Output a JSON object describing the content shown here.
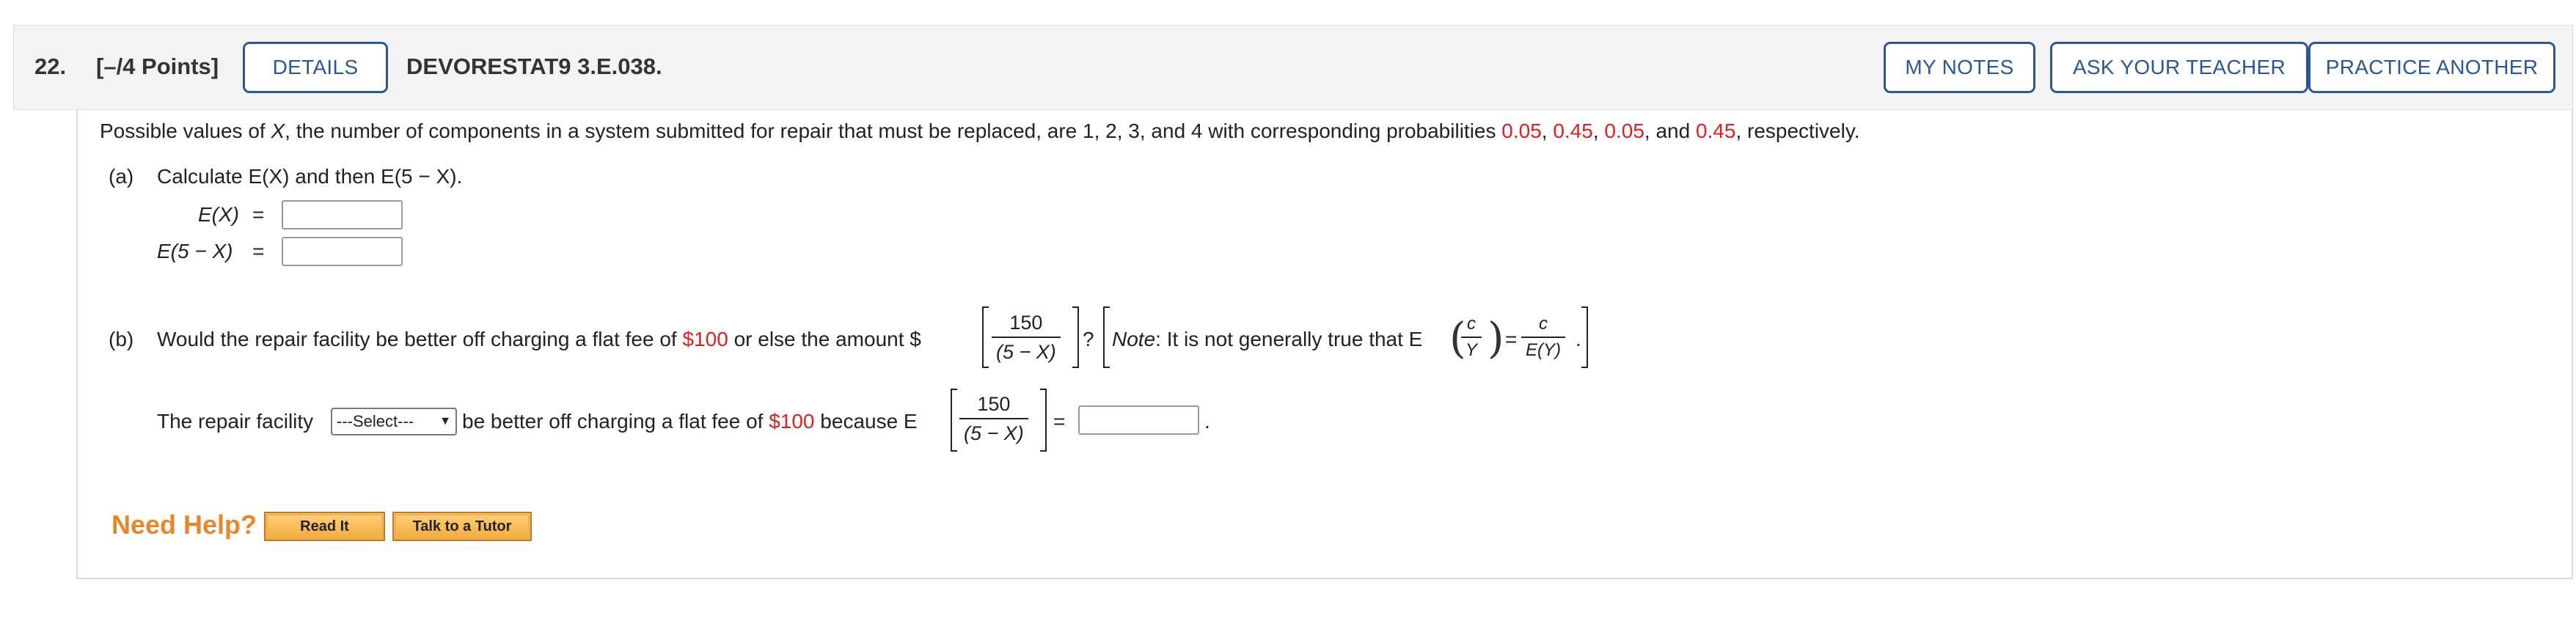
{
  "header": {
    "question_number": "22.",
    "points": "[–/4 Points]",
    "details_label": "DETAILS",
    "problem_code": "DEVORESTAT9 3.E.038.",
    "my_notes_label": "MY NOTES",
    "ask_teacher_label": "ASK YOUR TEACHER",
    "practice_another_label": "PRACTICE ANOTHER"
  },
  "intro": {
    "p1": "Possible values of ",
    "var_x": "X",
    "p2": ", the number of components in a system submitted for repair that must be replaced, are 1, 2, 3, and 4 with corresponding probabilities ",
    "prob1": "0.05",
    "sep1": ", ",
    "prob2": "0.45",
    "sep2": ", ",
    "prob3": "0.05",
    "sep3": ", and ",
    "prob4": "0.45",
    "p3": ", respectively."
  },
  "part_a": {
    "label": "(a)",
    "prompt": "Calculate E(X) and then E(5 − X).",
    "ex_label": "E(X)",
    "ex_equals": "=",
    "e5x_label": "E(5 − X)",
    "e5x_equals": "=",
    "ex_value": "",
    "e5x_value": ""
  },
  "part_b": {
    "label": "(b)",
    "prompt_1": "Would the repair facility be better off charging a flat fee of ",
    "fee": "$100",
    "prompt_2": " or else the amount $",
    "frac_num": "150",
    "frac_den": "(5 − X)",
    "qmark": "?",
    "note_label": "Note",
    "note_text": ": It is not generally true that E",
    "note_frac_num": "c",
    "note_frac_den": "Y",
    "note_equals": "=",
    "note_rhs_num": "c",
    "note_rhs_den": "E(Y)",
    "note_end": ".",
    "answer_1": "The repair facility",
    "select_value": "---Select---",
    "answer_2": " be better off charging a flat fee of ",
    "answer_fee": "$100",
    "answer_3": " because E",
    "answer_frac_num": "150",
    "answer_frac_den": "(5 − X)",
    "answer_equals": "=",
    "answer_value": "",
    "answer_end": "."
  },
  "help": {
    "need_help": "Need Help?",
    "read_it": "Read It",
    "talk_tutor": "Talk to a Tutor"
  },
  "colors": {
    "accent": "#2b5797",
    "highlight": "#e02020",
    "help": "#e8862a"
  }
}
